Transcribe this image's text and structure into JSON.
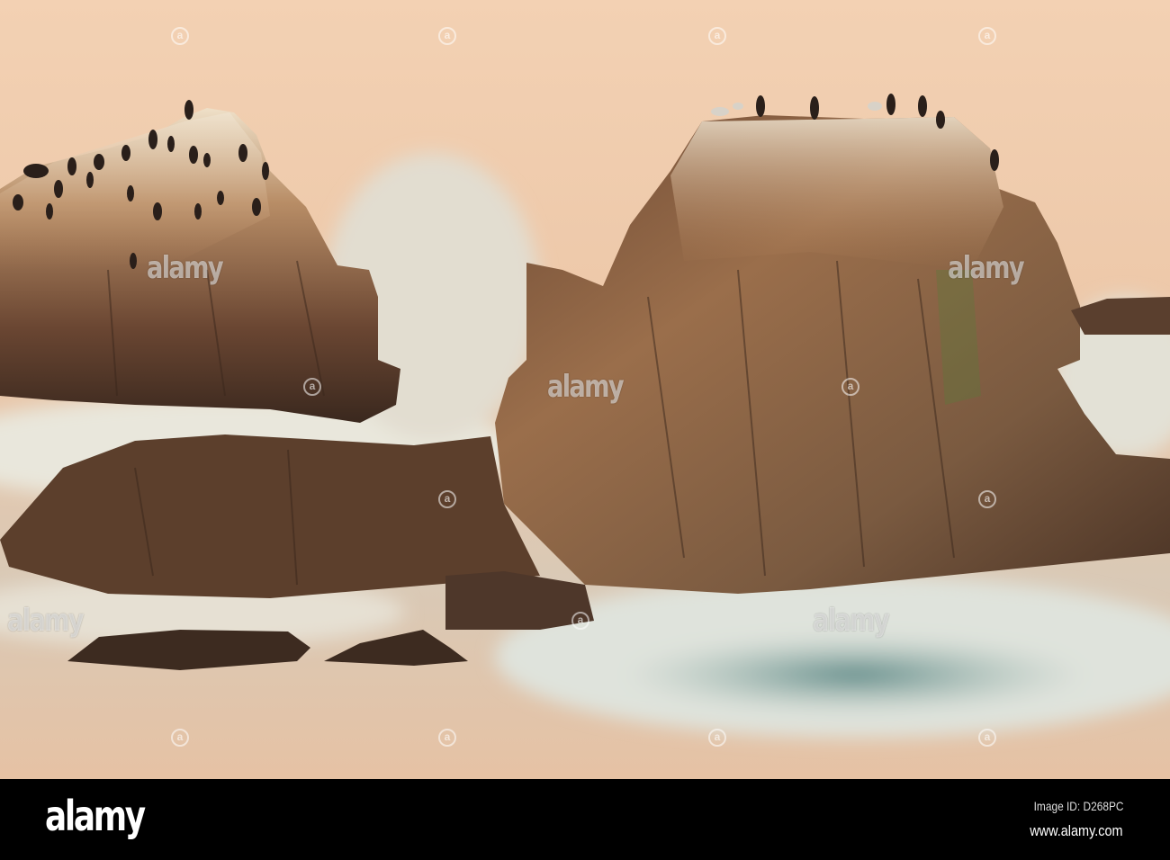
{
  "photo": {
    "subject": "Cormorants on sea rocks at dusk",
    "colors": {
      "sea": "#f1cdb0",
      "rock_dark": "#4a3325",
      "rock_light": "#c79a6a",
      "foam": "#e6e4d8",
      "bird": "#2a1f1a"
    }
  },
  "watermark": {
    "text": "alamy",
    "logo_letter": "a"
  },
  "footer": {
    "logo": "alamy",
    "image_id": "Image ID: D268PC",
    "url": "www.alamy.com"
  }
}
